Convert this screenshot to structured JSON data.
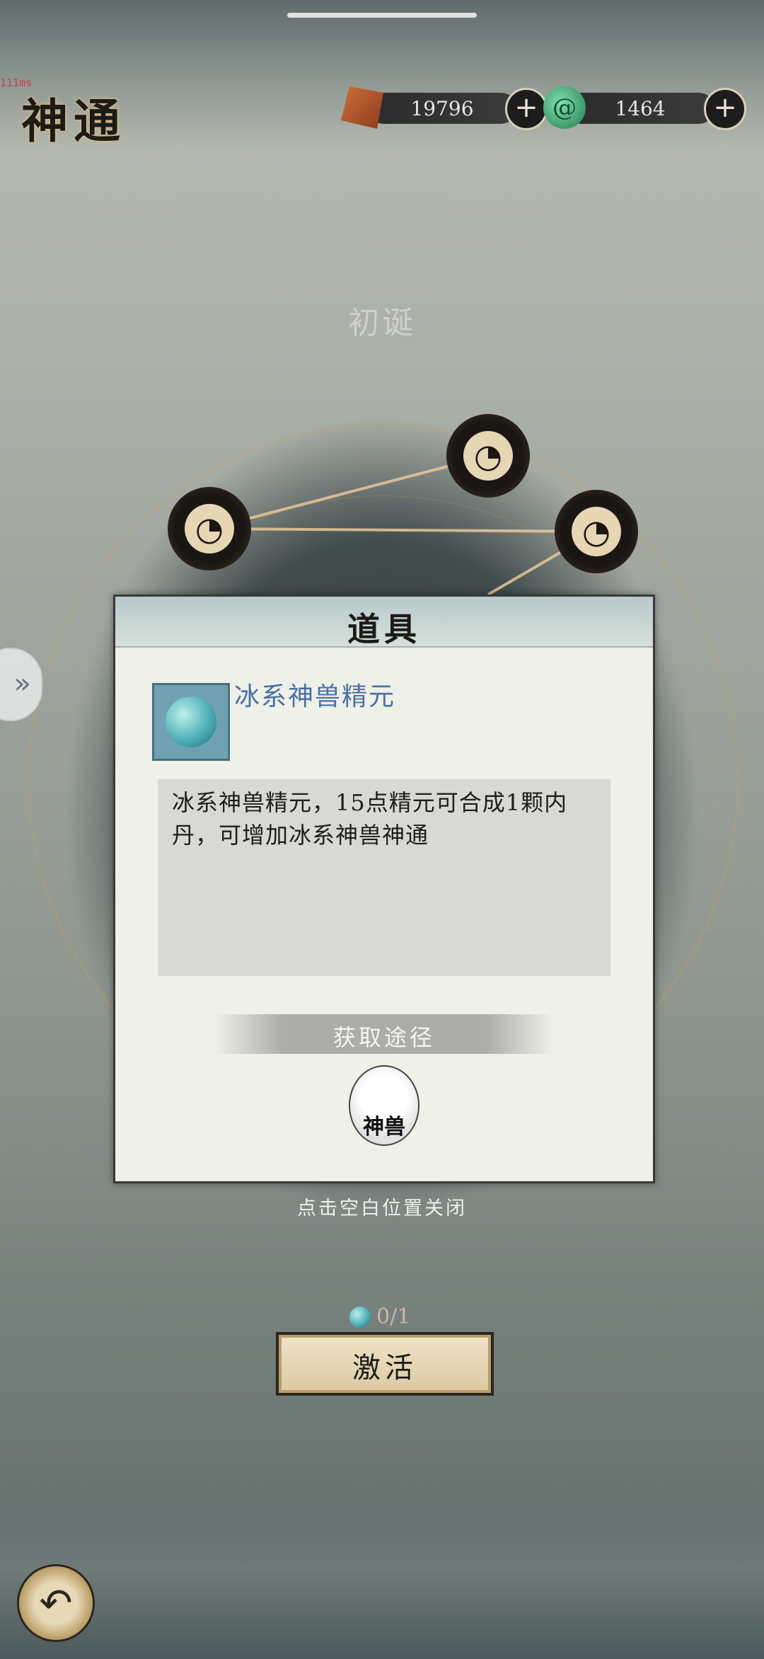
{
  "status": {
    "debug_text": "111ms"
  },
  "header": {
    "title": "神通"
  },
  "resources": [
    {
      "name": "gem",
      "icon": "red-gem-icon",
      "value": "19796",
      "add_symbol": "+"
    },
    {
      "name": "jade",
      "icon": "jade-swirl-icon",
      "value": "1464",
      "add_symbol": "+"
    }
  ],
  "stage": {
    "name": "初诞"
  },
  "nodes": [
    {
      "icon": "swirl-node-icon",
      "glyph": "◔"
    },
    {
      "icon": "swirl-node-icon",
      "glyph": "◔"
    },
    {
      "icon": "swirl-node-icon",
      "glyph": "◔"
    }
  ],
  "side_tab": {
    "icon": "double-chevron-right-icon",
    "glyph": "»"
  },
  "popup": {
    "title": "道具",
    "item_name": "冰系神兽精元",
    "description": "冰系神兽精元，15点精元可合成1颗内丹，可增加冰系神兽神通",
    "source_label": "获取途径",
    "source_icon_text": "神兽"
  },
  "close_hint": "点击空白位置关闭",
  "material_count": "0/1",
  "activate_label": "激活",
  "back_icon": "↶"
}
